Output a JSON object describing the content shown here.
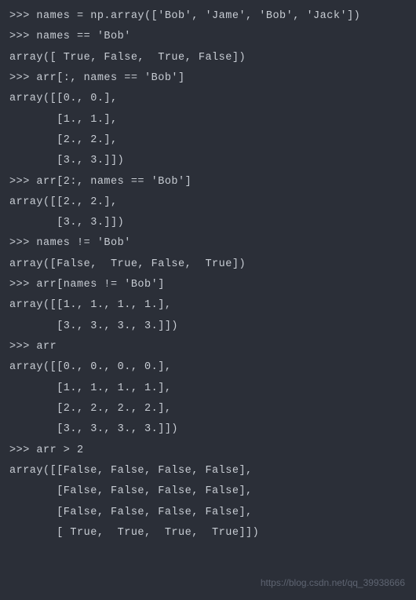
{
  "lines": [
    ">>> names = np.array(['Bob', 'Jame', 'Bob', 'Jack'])",
    ">>> names == 'Bob'",
    "array([ True, False,  True, False])",
    ">>> arr[:, names == 'Bob']",
    "array([[0., 0.],",
    "       [1., 1.],",
    "       [2., 2.],",
    "       [3., 3.]])",
    ">>> arr[2:, names == 'Bob']",
    "array([[2., 2.],",
    "       [3., 3.]])",
    ">>> names != 'Bob'",
    "array([False,  True, False,  True])",
    ">>> arr[names != 'Bob']",
    "array([[1., 1., 1., 1.],",
    "       [3., 3., 3., 3.]])",
    ">>> arr",
    "array([[0., 0., 0., 0.],",
    "       [1., 1., 1., 1.],",
    "       [2., 2., 2., 2.],",
    "       [3., 3., 3., 3.]])",
    ">>> arr > 2",
    "array([[False, False, False, False],",
    "       [False, False, False, False],",
    "       [False, False, False, False],",
    "       [ True,  True,  True,  True]])"
  ],
  "watermark": "https://blog.csdn.net/qq_39938666"
}
